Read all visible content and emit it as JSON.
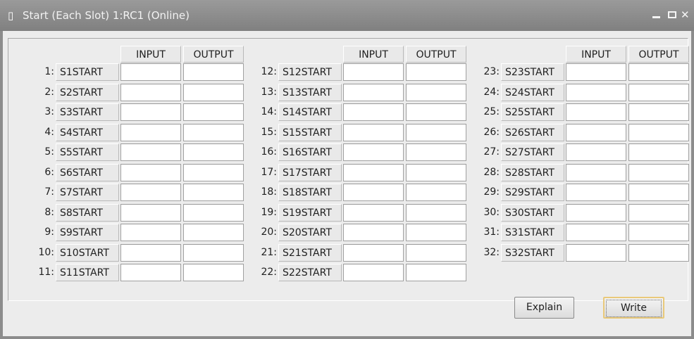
{
  "window": {
    "title": "Start (Each Slot) 1:RC1 (Online)",
    "icon": "document-icon",
    "controls": [
      "minimize-icon",
      "maximize-icon",
      "close-icon"
    ]
  },
  "columns": [
    {
      "header_input": "INPUT",
      "header_output": "OUTPUT",
      "rows": [
        {
          "num": "1:",
          "name": "S1START",
          "input": "",
          "output": ""
        },
        {
          "num": "2:",
          "name": "S2START",
          "input": "",
          "output": ""
        },
        {
          "num": "3:",
          "name": "S3START",
          "input": "",
          "output": ""
        },
        {
          "num": "4:",
          "name": "S4START",
          "input": "",
          "output": ""
        },
        {
          "num": "5:",
          "name": "S5START",
          "input": "",
          "output": ""
        },
        {
          "num": "6:",
          "name": "S6START",
          "input": "",
          "output": ""
        },
        {
          "num": "7:",
          "name": "S7START",
          "input": "",
          "output": ""
        },
        {
          "num": "8:",
          "name": "S8START",
          "input": "",
          "output": ""
        },
        {
          "num": "9:",
          "name": "S9START",
          "input": "",
          "output": ""
        },
        {
          "num": "10:",
          "name": "S10START",
          "input": "",
          "output": ""
        },
        {
          "num": "11:",
          "name": "S11START",
          "input": "",
          "output": ""
        }
      ]
    },
    {
      "header_input": "INPUT",
      "header_output": "OUTPUT",
      "rows": [
        {
          "num": "12:",
          "name": "S12START",
          "input": "",
          "output": ""
        },
        {
          "num": "13:",
          "name": "S13START",
          "input": "",
          "output": ""
        },
        {
          "num": "14:",
          "name": "S14START",
          "input": "",
          "output": ""
        },
        {
          "num": "15:",
          "name": "S15START",
          "input": "",
          "output": ""
        },
        {
          "num": "16:",
          "name": "S16START",
          "input": "",
          "output": ""
        },
        {
          "num": "17:",
          "name": "S17START",
          "input": "",
          "output": ""
        },
        {
          "num": "18:",
          "name": "S18START",
          "input": "",
          "output": ""
        },
        {
          "num": "19:",
          "name": "S19START",
          "input": "",
          "output": ""
        },
        {
          "num": "20:",
          "name": "S20START",
          "input": "",
          "output": ""
        },
        {
          "num": "21:",
          "name": "S21START",
          "input": "",
          "output": ""
        },
        {
          "num": "22:",
          "name": "S22START",
          "input": "",
          "output": ""
        }
      ]
    },
    {
      "header_input": "INPUT",
      "header_output": "OUTPUT",
      "rows": [
        {
          "num": "23:",
          "name": "S23START",
          "input": "",
          "output": ""
        },
        {
          "num": "24:",
          "name": "S24START",
          "input": "",
          "output": ""
        },
        {
          "num": "25:",
          "name": "S25START",
          "input": "",
          "output": ""
        },
        {
          "num": "26:",
          "name": "S26START",
          "input": "",
          "output": ""
        },
        {
          "num": "27:",
          "name": "S27START",
          "input": "",
          "output": ""
        },
        {
          "num": "28:",
          "name": "S28START",
          "input": "",
          "output": ""
        },
        {
          "num": "29:",
          "name": "S29START",
          "input": "",
          "output": ""
        },
        {
          "num": "30:",
          "name": "S30START",
          "input": "",
          "output": ""
        },
        {
          "num": "31:",
          "name": "S31START",
          "input": "",
          "output": ""
        },
        {
          "num": "32:",
          "name": "S32START",
          "input": "",
          "output": ""
        }
      ]
    }
  ],
  "buttons": {
    "explain": "Explain",
    "write": "Write"
  }
}
